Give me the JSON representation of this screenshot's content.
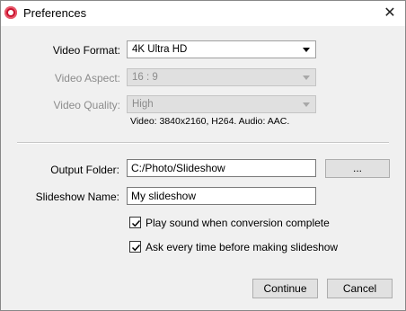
{
  "window": {
    "title": "Preferences",
    "close_glyph": "✕"
  },
  "video_format": {
    "label": "Video Format:",
    "value": "4K Ultra HD"
  },
  "video_aspect": {
    "label": "Video Aspect:",
    "value": "16 : 9"
  },
  "video_quality": {
    "label": "Video Quality:",
    "value": "High"
  },
  "video_info": "Video: 3840x2160, H264. Audio: AAC.",
  "output_folder": {
    "label": "Output Folder:",
    "value": "C:/Photo/Slideshow",
    "browse_label": "..."
  },
  "slideshow_name": {
    "label": "Slideshow Name:",
    "value": "My slideshow"
  },
  "checkboxes": [
    {
      "label": "Play sound when conversion complete",
      "checked": true
    },
    {
      "label": "Ask every time before making slideshow",
      "checked": true
    }
  ],
  "buttons": {
    "continue": "Continue",
    "cancel": "Cancel"
  }
}
